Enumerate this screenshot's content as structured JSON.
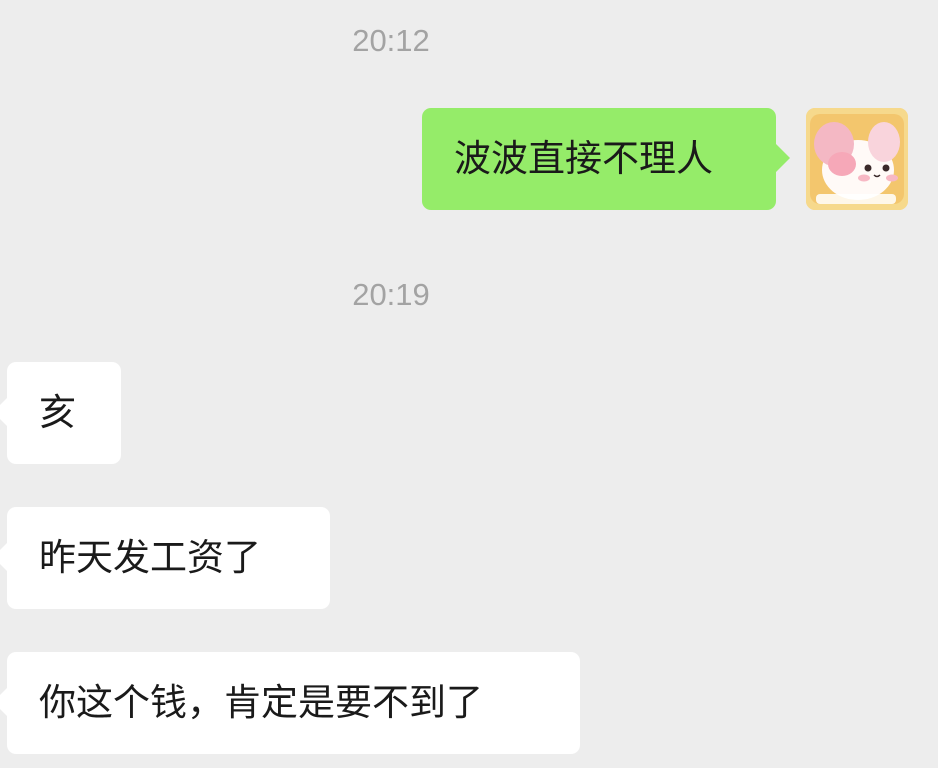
{
  "chat": {
    "messages": [
      {
        "type": "time",
        "text": "20:12"
      },
      {
        "type": "sent",
        "text": "波波直接不理人"
      },
      {
        "type": "time",
        "text": "20:19"
      },
      {
        "type": "received",
        "text": "亥"
      },
      {
        "type": "received",
        "text": "昨天发工资了"
      },
      {
        "type": "received",
        "text": "你这个钱，肯定是要不到了"
      }
    ]
  },
  "colors": {
    "background": "#ededed",
    "sent_bubble": "#95ec69",
    "received_bubble": "#ffffff",
    "timestamp_text": "#a3a3a3"
  },
  "icons": {
    "self_avatar": "cartoon-bunny-avatar-icon"
  }
}
